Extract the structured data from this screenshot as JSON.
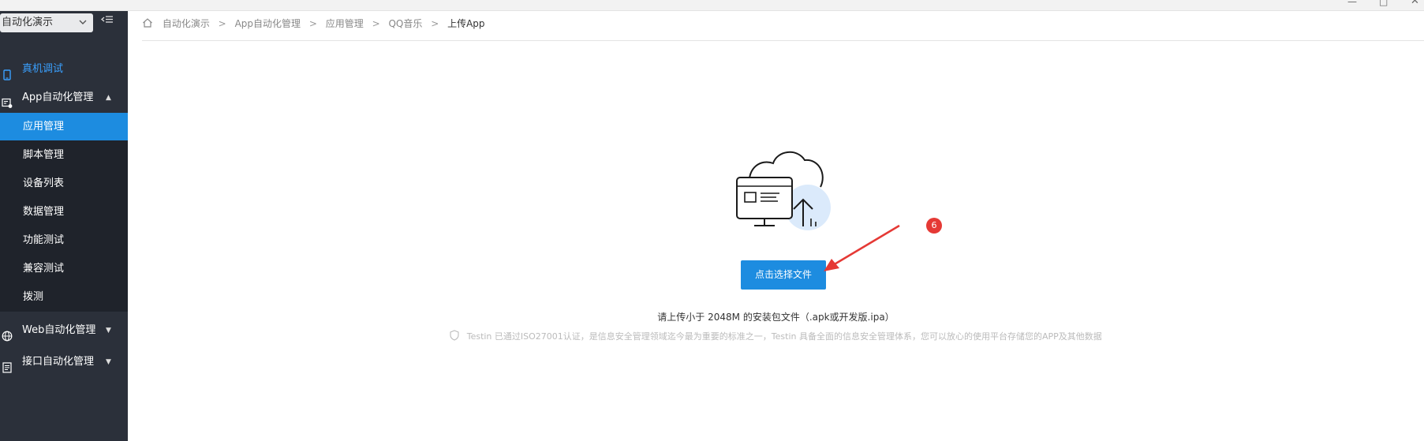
{
  "window": {
    "controls": {
      "minimize": "—",
      "maximize": "□",
      "close": "✕"
    }
  },
  "sidebar": {
    "project_select": {
      "value": "自动化演示",
      "icon": "chevron-down-icon"
    },
    "collapse_icon": "menu-collapse-icon",
    "menu": {
      "device": {
        "label": "真机调试",
        "icon": "phone-icon"
      },
      "app_auto": {
        "label": "App自动化管理",
        "icon": "app-settings-icon",
        "caret": "▲"
      },
      "web_auto": {
        "label": "Web自动化管理",
        "icon": "globe-icon",
        "caret": "▼"
      },
      "api_auto": {
        "label": "接口自动化管理",
        "icon": "document-icon",
        "caret": "▼"
      }
    },
    "submenu": [
      {
        "label": "应用管理",
        "active": true
      },
      {
        "label": "脚本管理"
      },
      {
        "label": "设备列表"
      },
      {
        "label": "数据管理"
      },
      {
        "label": "功能测试"
      },
      {
        "label": "兼容测试"
      },
      {
        "label": "拨测"
      }
    ]
  },
  "breadcrumb": {
    "items": [
      "自动化演示",
      "App自动化管理",
      "应用管理",
      "QQ音乐",
      "上传App"
    ],
    "separator": ">"
  },
  "upload": {
    "button_label": "点击选择文件",
    "hint": "请上传小于 2048M 的安装包文件（.apk或开发版.ipa）",
    "certification": "Testin 已通过ISO27001认证，是信息安全管理领域迄今最为重要的标准之一，Testin 具备全面的信息安全管理体系，您可以放心的使用平台存储您的APP及其他数据"
  },
  "annotation": {
    "badge": "6",
    "color": "#e53935"
  },
  "colors": {
    "sidebar_bg": "#2b303a",
    "submenu_bg": "#1f232b",
    "accent": "#1d8ce0",
    "device_link": "#3aa0ff"
  }
}
